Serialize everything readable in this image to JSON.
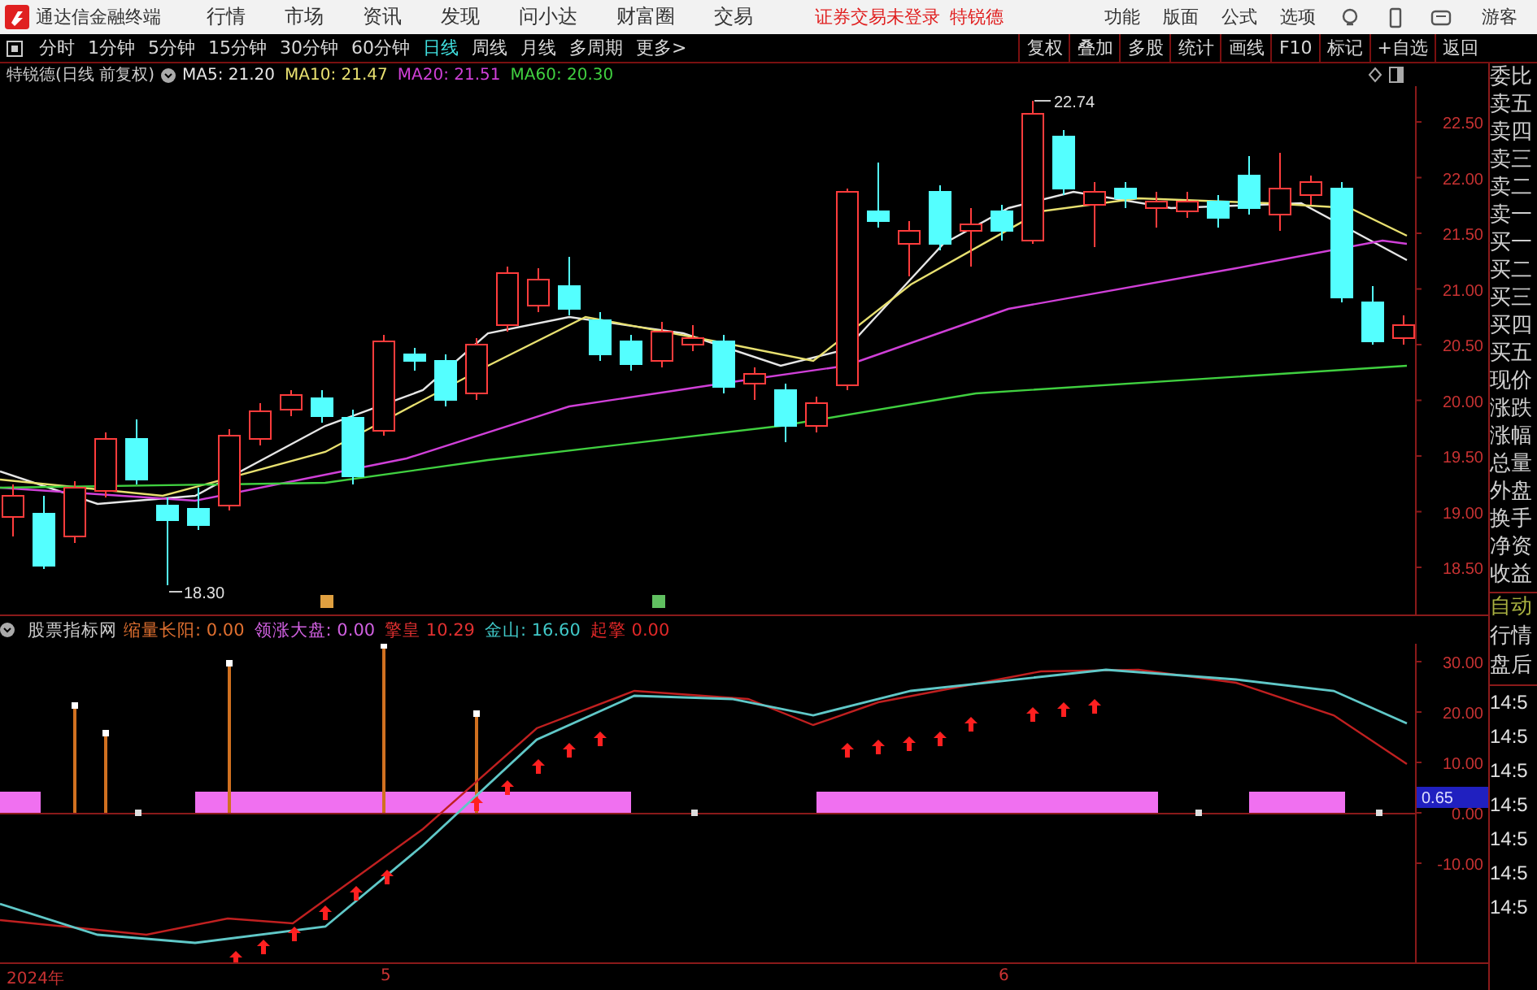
{
  "app": {
    "title": "通达信金融终端"
  },
  "menu": [
    "行情",
    "市场",
    "资讯",
    "发现",
    "问小达",
    "财富圈",
    "交易"
  ],
  "login_status": "证券交易未登录",
  "login_stock": "特锐德",
  "top_right_menu": [
    "功能",
    "版面",
    "公式",
    "选项"
  ],
  "user": "游客",
  "periods": [
    {
      "label": "分时",
      "selected": false
    },
    {
      "label": "1分钟",
      "selected": false
    },
    {
      "label": "5分钟",
      "selected": false
    },
    {
      "label": "15分钟",
      "selected": false
    },
    {
      "label": "30分钟",
      "selected": false
    },
    {
      "label": "60分钟",
      "selected": false
    },
    {
      "label": "日线",
      "selected": true
    },
    {
      "label": "周线",
      "selected": false
    },
    {
      "label": "月线",
      "selected": false
    },
    {
      "label": "多周期",
      "selected": false
    },
    {
      "label": "更多>",
      "selected": false
    }
  ],
  "tools": [
    "复权",
    "叠加",
    "多股",
    "统计",
    "画线",
    "F10",
    "标记",
    "+自选",
    "返回"
  ],
  "chart": {
    "title": "特锐德(日线 前复权)",
    "ma": [
      {
        "label": "MA5: 21.20",
        "color": "#e6e6e6"
      },
      {
        "label": "MA10: 21.47",
        "color": "#e8e070"
      },
      {
        "label": "MA20: 21.51",
        "color": "#d040d8"
      },
      {
        "label": "MA60: 20.30",
        "color": "#40d040"
      }
    ],
    "high_label": "22.74",
    "low_label": "18.30",
    "price_axis": [
      "22.50",
      "22.00",
      "21.50",
      "21.00",
      "20.50",
      "20.00",
      "19.50",
      "19.00",
      "18.50"
    ]
  },
  "indicator": {
    "title": "股票指标网",
    "values": [
      {
        "label": "缩量长阳:",
        "value": "0.00",
        "color": "#e07030"
      },
      {
        "label": "领涨大盘:",
        "value": "0.00",
        "color": "#d060e0"
      },
      {
        "label": "擎皇",
        "value": "10.29",
        "color": "#e03030"
      },
      {
        "label": "金山:",
        "value": "16.60",
        "color": "#40c8c8"
      },
      {
        "label": "起擎",
        "value": "0.00",
        "color": "#e02828"
      }
    ],
    "axis": [
      "30.00",
      "20.00",
      "10.00",
      "0.00",
      "-10.00"
    ],
    "current": "0.65"
  },
  "dates": [
    "2024年",
    "5",
    "6"
  ],
  "side_panel": {
    "quote_labels": [
      "委比",
      "卖五",
      "卖四",
      "卖三",
      "卖二",
      "卖一",
      "买一",
      "买二",
      "买三",
      "买四",
      "买五",
      "现价",
      "涨跌",
      "涨幅",
      "总量",
      "外盘",
      "换手",
      "净资",
      "收益"
    ],
    "modes": [
      "自动",
      "行情",
      "盘后"
    ],
    "times": [
      "14:5",
      "14:5",
      "14:5",
      "14:5",
      "14:5",
      "14:5",
      "14:5"
    ]
  }
}
